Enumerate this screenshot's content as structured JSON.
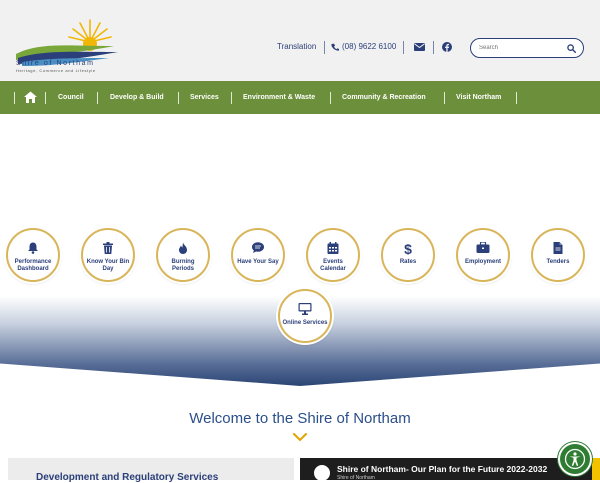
{
  "logo": {
    "name": "Shire of Northam",
    "tagline": "Heritage, Commerce and Lifestyle"
  },
  "utility": {
    "translation": "Translation",
    "phone": "(08) 9622 6100",
    "search_placeholder": "Search"
  },
  "nav": {
    "items": [
      "Council",
      "Develop & Build",
      "Services",
      "Environment & Waste",
      "Community & Recreation",
      "Visit Northam"
    ]
  },
  "quick_links": [
    {
      "label": "Performance Dashboard",
      "icon": "bell-icon"
    },
    {
      "label": "Know Your Bin Day",
      "icon": "trash-icon"
    },
    {
      "label": "Burning Periods",
      "icon": "flame-icon"
    },
    {
      "label": "Have Your Say",
      "icon": "speech-bubble-icon"
    },
    {
      "label": "Events Calendar",
      "icon": "calendar-icon"
    },
    {
      "label": "Rates",
      "icon": "dollar-icon"
    },
    {
      "label": "Employment",
      "icon": "briefcase-icon"
    },
    {
      "label": "Tenders",
      "icon": "document-icon"
    },
    {
      "label": "Online Services",
      "icon": "monitor-icon"
    }
  ],
  "welcome": "Welcome to the Shire of Northam",
  "card": {
    "title": "Development and Regulatory Services"
  },
  "video": {
    "title": "Shire of Northam- Our Plan for the Future 2022-2032",
    "channel": "Shire of Northam"
  },
  "colors": {
    "nav_green": "#6b8f3a",
    "brand_blue": "#2b3f7a",
    "gold": "#d9b55a"
  }
}
